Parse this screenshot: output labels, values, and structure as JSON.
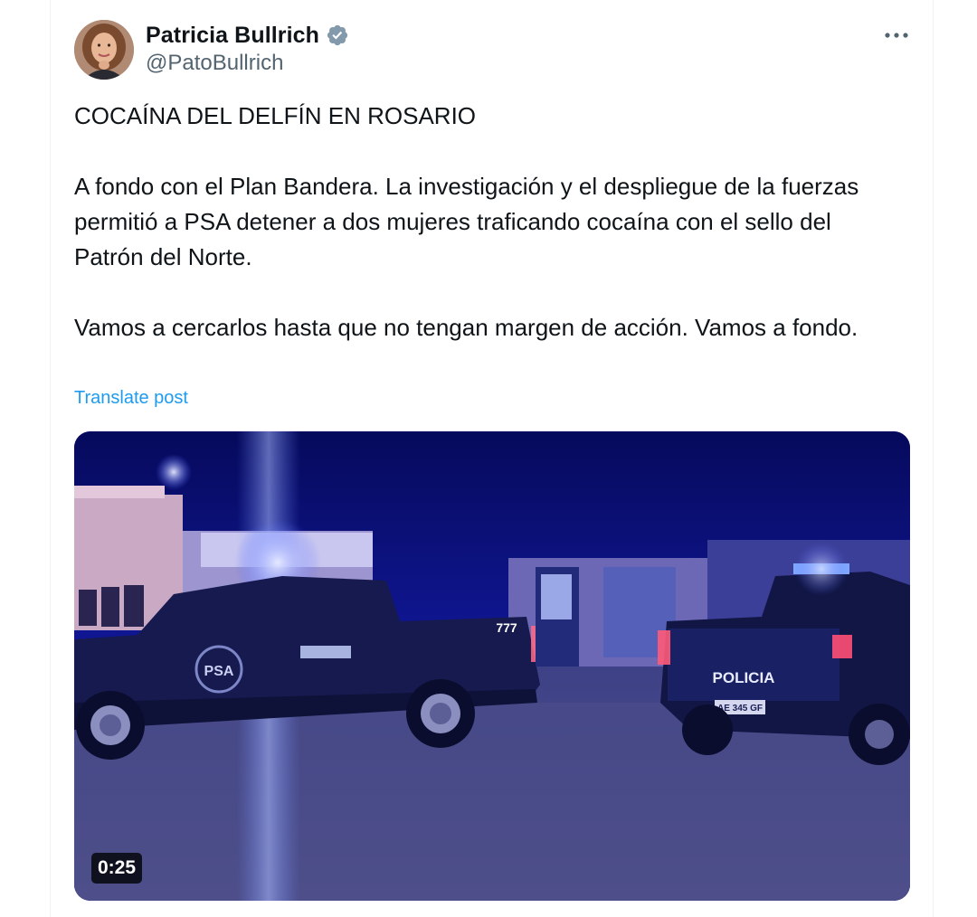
{
  "author": {
    "display_name": "Patricia Bullrich",
    "handle": "@PatoBullrich",
    "verified": true
  },
  "tweet": {
    "paragraphs": [
      "COCAÍNA DEL DELFÍN EN ROSARIO",
      "A fondo con el Plan Bandera. La investigación y el despliegue de la fuerzas permitió a PSA detener a dos mujeres traficando cocaína con el sello del Patrón del Norte.",
      "Vamos a cercarlos hasta que no tengan margen de acción. Vamos a fondo."
    ],
    "translate_label": "Translate post"
  },
  "media": {
    "type": "video",
    "duration": "0:25",
    "vehicle_left_text": "PSA",
    "vehicle_left_number": "777",
    "vehicle_right_text": "POLICIA",
    "vehicle_right_plate": "AE 345 GF"
  },
  "icons": {
    "verified": "verified-badge-icon",
    "more": "more-options-icon"
  },
  "colors": {
    "verified_badge": "#829aab",
    "link": "#1d9bf0",
    "secondary_text": "#536471"
  }
}
